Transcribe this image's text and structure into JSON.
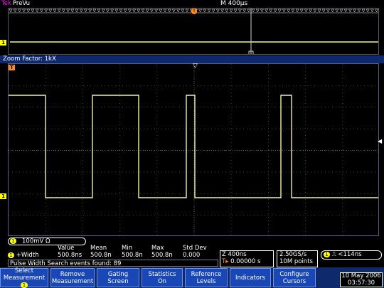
{
  "status": {
    "tek": "Tek",
    "title": "PreVu",
    "timebase": "M 400µs"
  },
  "zoom": {
    "factor": "Zoom Factor: 1kX"
  },
  "markers": {
    "ch1": "1",
    "trigger": "T"
  },
  "channel": {
    "scale": "100mV Ω"
  },
  "measurement": {
    "headers": [
      "",
      "Value",
      "Mean",
      "Min",
      "Max",
      "Std Dev"
    ],
    "row": {
      "label": "+Width",
      "value": "500.8ns",
      "mean": "500.8n",
      "min": "500.8n",
      "max": "500.8n",
      "std": "0.000"
    }
  },
  "search": {
    "text": "Pulse Width Search events found: 89"
  },
  "zoom_readout": {
    "line1": "Z 400ns",
    "line2": "0.00000 s"
  },
  "rate_readout": {
    "line1": "2.50GS/s",
    "line2": "10M points"
  },
  "trigger_readout": {
    "text": "<114ns"
  },
  "buttons": {
    "select": "Select Measurement",
    "remove": "Remove Measurement",
    "gating": {
      "l1": "Gating",
      "l2": "Screen"
    },
    "stats": {
      "l1": "Statistics",
      "l2": "On"
    },
    "ref": {
      "l1": "Reference",
      "l2": "Levels"
    },
    "ind": "Indicators",
    "cursors": {
      "l1": "Configure",
      "l2": "Cursors"
    }
  },
  "datetime": {
    "date": "10 May 2006",
    "time": "03:57:30"
  },
  "colors": {
    "trace": "#f2f2a0",
    "ch1": "#ffff00",
    "trigger": "#ff8c1a",
    "bar": "#0e2a6d",
    "button": "#1947b5"
  }
}
